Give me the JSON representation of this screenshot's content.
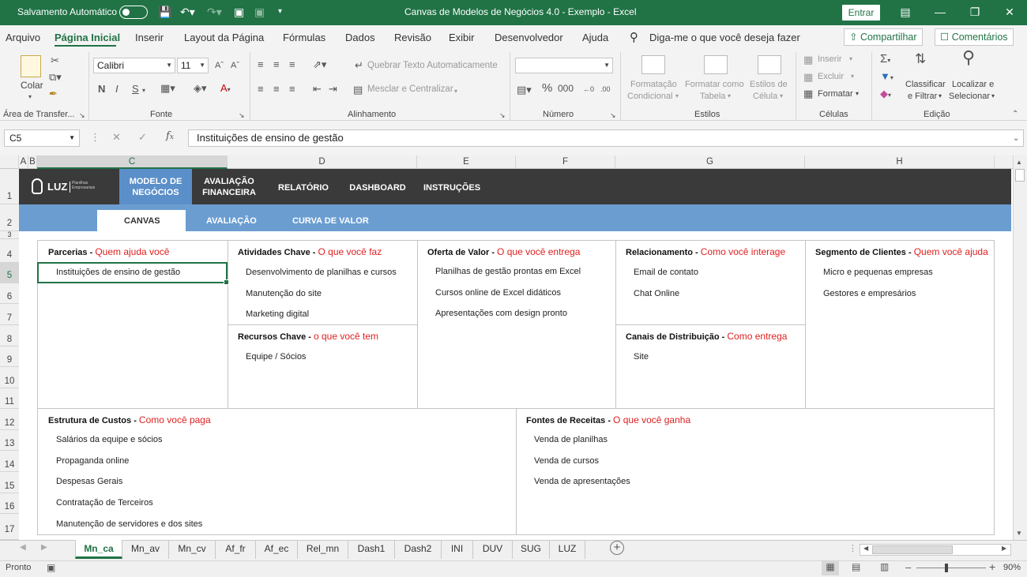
{
  "titlebar": {
    "autosave": "Salvamento Automático",
    "title": "Canvas de Modelos de Negócios 4.0 - Exemplo  -  Excel",
    "enter": "Entrar"
  },
  "menu": {
    "items": [
      "Arquivo",
      "Página Inicial",
      "Inserir",
      "Layout da Página",
      "Fórmulas",
      "Dados",
      "Revisão",
      "Exibir",
      "Desenvolvedor",
      "Ajuda"
    ],
    "search": "Diga-me o que você deseja fazer",
    "share": "Compartilhar",
    "comments": "Comentários"
  },
  "ribbon": {
    "clipboard": {
      "paste": "Colar",
      "group": "Área de Transfer..."
    },
    "font": {
      "name": "Calibri",
      "size": "11",
      "bold": "N",
      "italic": "I",
      "underline": "S",
      "group": "Fonte"
    },
    "alignment": {
      "wrap": "Quebrar Texto Automaticamente",
      "merge": "Mesclar e Centralizar",
      "group": "Alinhamento"
    },
    "number": {
      "group": "Número",
      "percent": "%"
    },
    "styles": {
      "cond1": "Formatação",
      "cond2": "Condicional",
      "table1": "Formatar como",
      "table2": "Tabela",
      "cell1": "Estilos de",
      "cell2": "Célula",
      "group": "Estilos"
    },
    "cells": {
      "insert": "Inserir",
      "delete": "Excluir",
      "format": "Formatar",
      "group": "Células"
    },
    "editing": {
      "sort1": "Classificar",
      "sort2": "e Filtrar",
      "find1": "Localizar e",
      "find2": "Selecionar",
      "group": "Edição"
    }
  },
  "formula": {
    "cell": "C5",
    "value": "Instituições de ensino de gestão"
  },
  "columns": [
    "A",
    "B",
    "C",
    "D",
    "E",
    "F",
    "G",
    "H"
  ],
  "rows": [
    "1",
    "2",
    "3",
    "4",
    "5",
    "6",
    "7",
    "8",
    "9",
    "10",
    "11",
    "12",
    "13",
    "14",
    "15",
    "16",
    "17"
  ],
  "nav": {
    "brand": "LUZ",
    "brand_sub": "Planilhas Empresariais",
    "items": [
      [
        "MODELO DE",
        "NEGÓCIOS"
      ],
      [
        "AVALIAÇÃO",
        "FINANCEIRA"
      ],
      [
        "RELATÓRIO"
      ],
      [
        "DASHBOARD"
      ],
      [
        "INSTRUÇÕES"
      ]
    ],
    "sub": [
      "CANVAS",
      "AVALIAÇÃO",
      "CURVA DE VALOR"
    ]
  },
  "canvas": {
    "parcerias": {
      "title": "Parcerias",
      "dash": " - ",
      "subtitle": "Quem ajuda você",
      "items": [
        "Instituições de ensino de gestão"
      ]
    },
    "atividades": {
      "title": "Atividades Chave",
      "dash": " - ",
      "subtitle": "O que você faz",
      "items": [
        "Desenvolvimento de planilhas e cursos",
        "Manutenção do site",
        "Marketing digital"
      ]
    },
    "recursos": {
      "title": "Recursos Chave",
      "dash": " - ",
      "subtitle": "o que você tem",
      "items": [
        "Equipe / Sócios"
      ]
    },
    "oferta": {
      "title": "Oferta de Valor",
      "dash": " - ",
      "subtitle": "O que você entrega",
      "items": [
        "Planilhas de gestão prontas em Excel",
        "Cursos online de Excel didáticos",
        "Apresentações com design pronto"
      ]
    },
    "relacionamento": {
      "title": "Relacionamento",
      "dash": " - ",
      "subtitle": "Como você interage",
      "items": [
        "Email de contato",
        "Chat Online"
      ]
    },
    "canais": {
      "title": "Canais de Distribuição",
      "dash": " - ",
      "subtitle": "Como entrega",
      "items": [
        "Site"
      ]
    },
    "segmento": {
      "title": "Segmento de Clientes",
      "dash": " - ",
      "subtitle": "Quem você ajuda",
      "items": [
        "Micro e pequenas empresas",
        "Gestores e empresários"
      ]
    },
    "custos": {
      "title": "Estrutura de Custos",
      "dash": " - ",
      "subtitle": "Como você paga",
      "items": [
        "Salários da equipe e sócios",
        "Propaganda online",
        "Despesas Gerais",
        "Contratação de Terceiros",
        "Manutenção de servidores e dos sites"
      ]
    },
    "receitas": {
      "title": "Fontes de Receitas",
      "dash": " - ",
      "subtitle": "O que você ganha",
      "items": [
        "Venda de planilhas",
        "Venda de cursos",
        "Venda de apresentações"
      ]
    }
  },
  "sheets": [
    "Mn_ca",
    "Mn_av",
    "Mn_cv",
    "Af_fr",
    "Af_ec",
    "Rel_mn",
    "Dash1",
    "Dash2",
    "INI",
    "DUV",
    "SUG",
    "LUZ"
  ],
  "status": {
    "ready": "Pronto",
    "zoom": "90%"
  },
  "colors": {
    "excel_green": "#217346",
    "nav_dark": "#3a3a3a",
    "nav_blue": "#6b9dd1",
    "accent_red": "#e02020"
  }
}
